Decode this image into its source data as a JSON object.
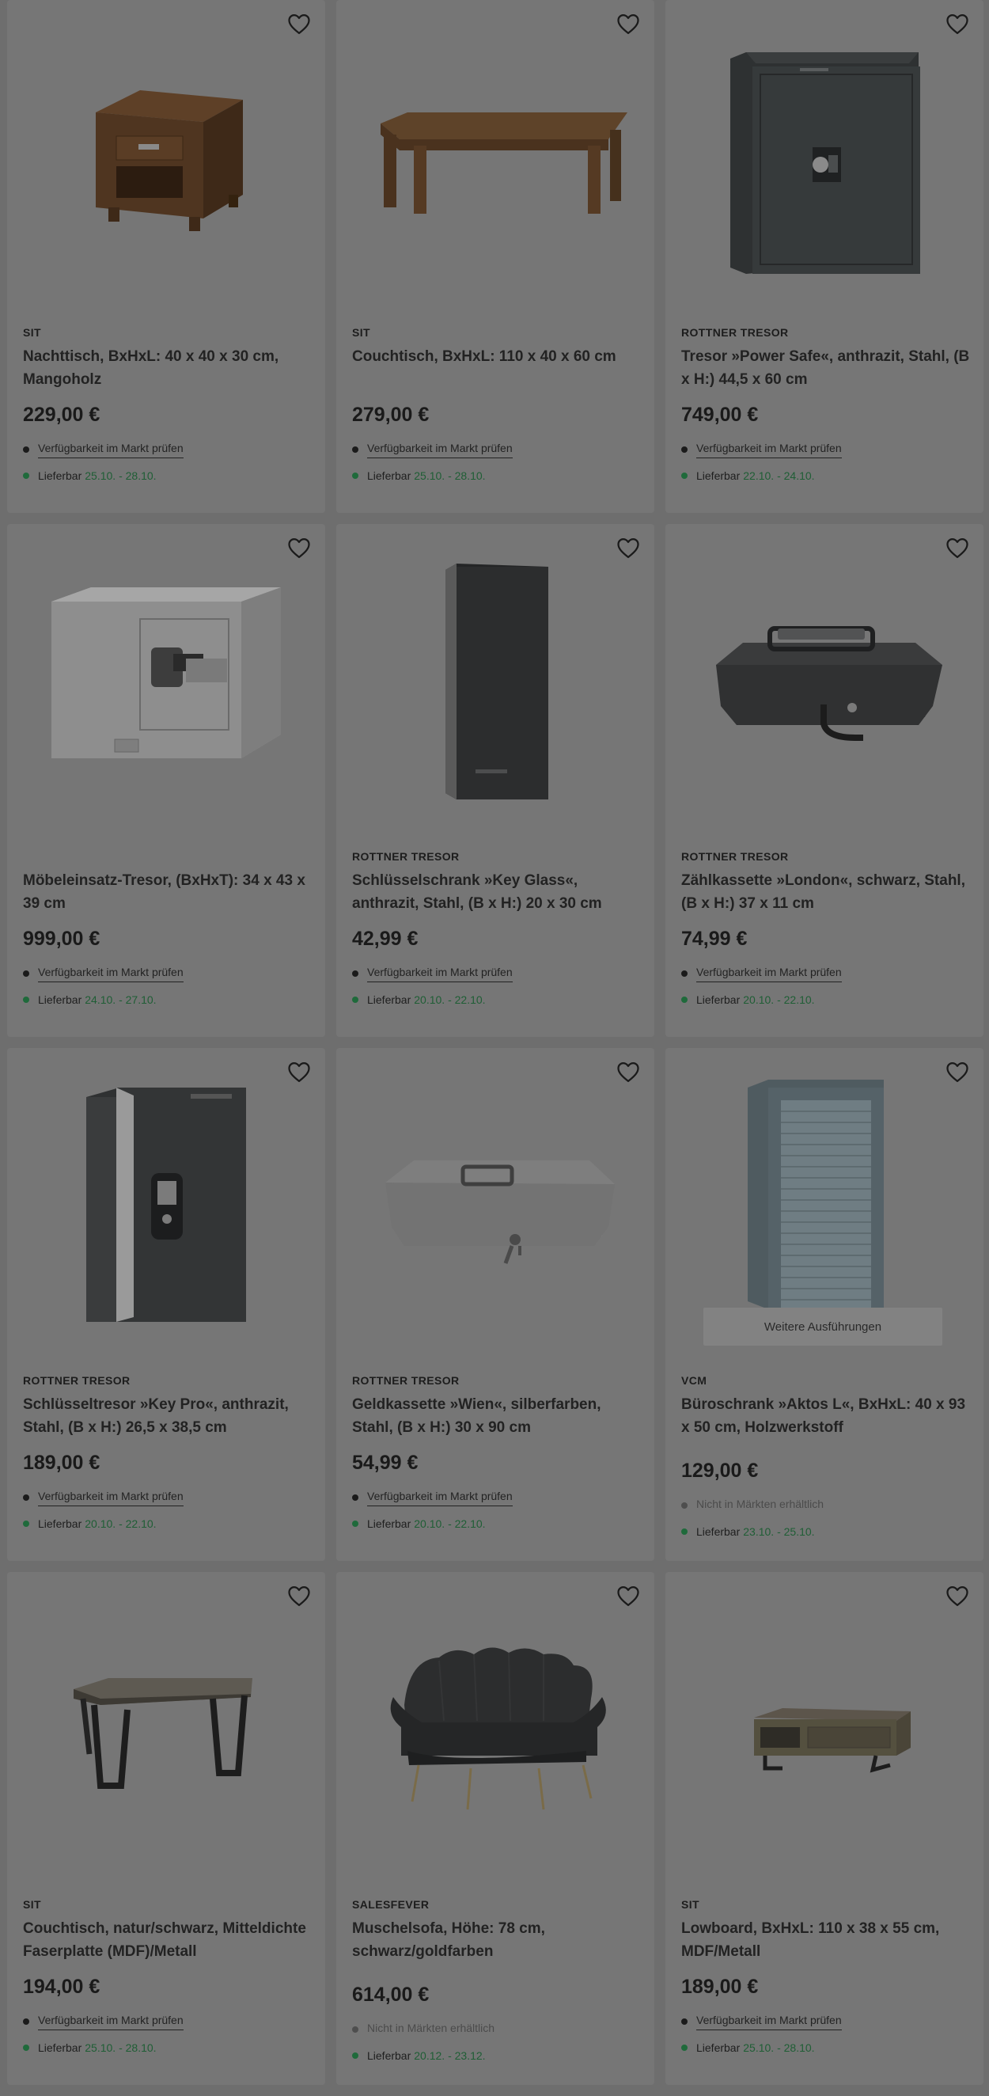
{
  "ui": {
    "availability_check": "Verfügbarkeit im Markt prüfen",
    "delivery_prefix": "Lieferbar",
    "more_variants": "Weitere Ausführungen",
    "colors": {
      "overlay_bg": "#6e6e6e",
      "card_bg": "#767676",
      "delivery_green": "#1f6a3b"
    }
  },
  "products": [
    {
      "brand": "SIT",
      "title": "Nachttisch, BxHxL: 40 x 40 x 30 cm, Mangoholz",
      "price": "229,00 €",
      "availability": "Verfügbarkeit im Markt prüfen",
      "delivery": "25.10. - 28.10.",
      "image": "nightstand-wood"
    },
    {
      "brand": "SIT",
      "title": "Couchtisch, BxHxL: 110 x 40 x 60 cm",
      "price": "279,00 €",
      "availability": "Verfügbarkeit im Markt prüfen",
      "delivery": "25.10. - 28.10.",
      "image": "coffee-table-wood"
    },
    {
      "brand": "ROTTNER TRESOR",
      "title": "Tresor »Power Safe«, anthrazit, Stahl, (B x H:) 44,5 x 60 cm",
      "price": "749,00 €",
      "availability": "Verfügbarkeit im Markt prüfen",
      "delivery": "22.10. - 24.10.",
      "image": "safe-anthracite"
    },
    {
      "brand": "",
      "title": "Möbeleinsatz-Tresor, (BxHxT): 34 x 43 x 39 cm",
      "price": "999,00 €",
      "availability": "Verfügbarkeit im Markt prüfen",
      "delivery": "24.10. - 27.10.",
      "image": "safe-grey"
    },
    {
      "brand": "ROTTNER TRESOR",
      "title": "Schlüsselschrank »Key Glass«, anthrazit, Stahl, (B x H:) 20 x 30 cm",
      "price": "42,99 €",
      "availability": "Verfügbarkeit im Markt prüfen",
      "delivery": "20.10. - 22.10.",
      "image": "key-cabinet-glass"
    },
    {
      "brand": "ROTTNER TRESOR",
      "title": "Zählkassette »London«, schwarz, Stahl, (B x H:) 37 x 11 cm",
      "price": "74,99 €",
      "availability": "Verfügbarkeit im Markt prüfen",
      "delivery": "20.10. - 22.10.",
      "image": "cash-box-black"
    },
    {
      "brand": "ROTTNER TRESOR",
      "title": "Schlüsseltresor »Key Pro«, anthrazit, Stahl, (B x H:) 26,5 x 38,5 cm",
      "price": "189,00 €",
      "availability": "Verfügbarkeit im Markt prüfen",
      "delivery": "20.10. - 22.10.",
      "image": "key-safe-pro"
    },
    {
      "brand": "ROTTNER TRESOR",
      "title": "Geldkassette »Wien«, silberfarben, Stahl, (B x H:) 30 x 90 cm",
      "price": "54,99 €",
      "availability": "Verfügbarkeit im Markt prüfen",
      "delivery": "20.10. - 22.10.",
      "image": "cash-box-silver"
    },
    {
      "brand": "VCM",
      "title": "Büroschrank »Aktos L«, BxHxL: 40 x 93 x 50 cm, Holzwerkstoff",
      "price": "129,00 €",
      "availability": "Nicht in Märkten erhältlich",
      "delivery": "23.10. - 25.10.",
      "image": "office-cabinet",
      "more_variants": true,
      "not_in_store": true
    },
    {
      "brand": "SIT",
      "title": "Couchtisch, natur/schwarz, Mitteldichte Faserplatte (MDF)/Metall",
      "price": "194,00 €",
      "availability": "Verfügbarkeit im Markt prüfen",
      "delivery": "25.10. - 28.10.",
      "image": "coffee-table-metal"
    },
    {
      "brand": "SALESFEVER",
      "title": "Muschelsofa, Höhe: 78 cm, schwarz/goldfarben",
      "price": "614,00 €",
      "availability": "Nicht in Märkten erhältlich",
      "delivery": "20.12. - 23.12.",
      "image": "shell-sofa",
      "not_in_store": true
    },
    {
      "brand": "SIT",
      "title": "Lowboard, BxHxL: 110 x 38 x 55 cm, MDF/Metall",
      "price": "189,00 €",
      "availability": "Verfügbarkeit im Markt prüfen",
      "delivery": "25.10. - 28.10.",
      "image": "lowboard"
    }
  ]
}
